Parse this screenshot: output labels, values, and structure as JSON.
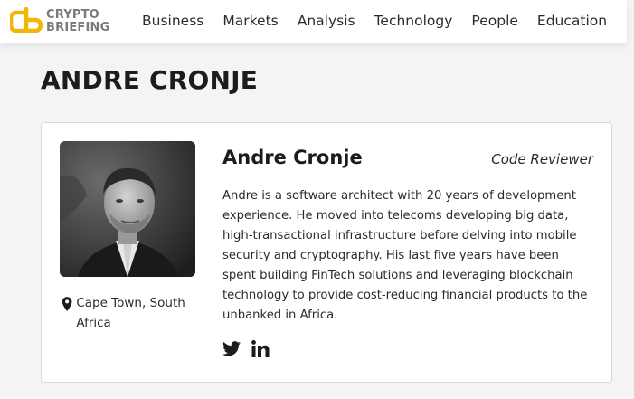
{
  "header": {
    "logo": {
      "line1": "CRYPTO",
      "line2": "BRIEFING",
      "accent_color": "#f2b705"
    },
    "nav": [
      {
        "label": "Business"
      },
      {
        "label": "Markets"
      },
      {
        "label": "Analysis"
      },
      {
        "label": "Technology"
      },
      {
        "label": "People"
      },
      {
        "label": "Education"
      }
    ]
  },
  "page": {
    "title": "ANDRE CRONJE"
  },
  "author": {
    "name": "Andre Cronje",
    "role": "Code Reviewer",
    "location": "Cape Town, South Africa",
    "bio": "Andre is a software architect with 20 years of development experience. He moved into telecoms developing big data, high-transactional infrastructure before delving into mobile security and cryptography. His last five years have been spent building FinTech solutions and leveraging blockchain technology to provide cost-reducing financial products to the unbanked in Africa.",
    "photo_icon": "author-portrait",
    "social": [
      {
        "icon": "twitter-icon"
      },
      {
        "icon": "linkedin-icon"
      }
    ]
  }
}
